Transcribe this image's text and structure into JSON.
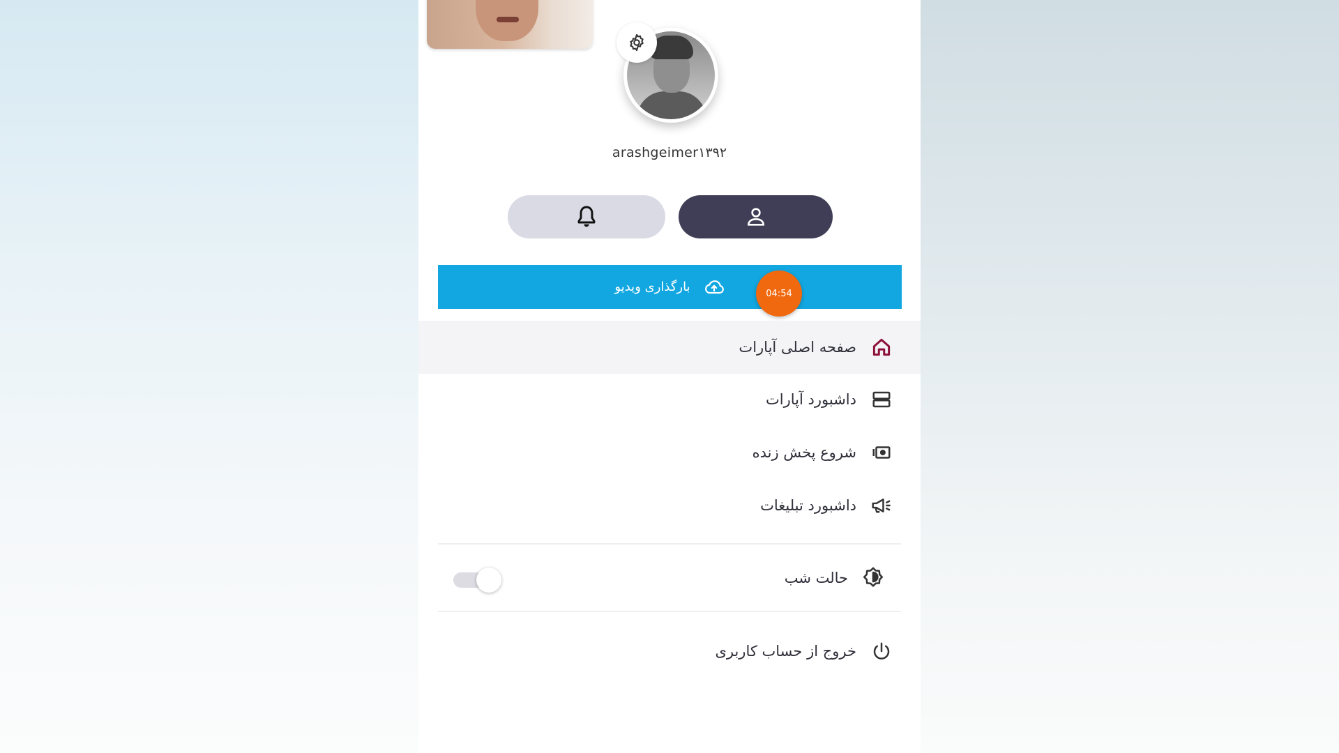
{
  "profile": {
    "username": "arashgeimer۱۳۹۲"
  },
  "buttons": {
    "upload_label": "بارگذاری ویدیو"
  },
  "recording": {
    "timer": "04:54",
    "color": "#f0690f"
  },
  "menu": {
    "items": [
      {
        "label": "صفحه اصلی آپارات",
        "icon": "home-icon"
      },
      {
        "label": "داشبورد آپارات",
        "icon": "dashboard-icon"
      },
      {
        "label": "شروع پخش زنده",
        "icon": "live-stream-icon"
      },
      {
        "label": "داشبورد تبلیغات",
        "icon": "megaphone-icon"
      }
    ],
    "night_mode_label": "حالت شب",
    "night_mode_on": false,
    "logout_label": "خروج از حساب کاربری"
  },
  "colors": {
    "accent": "#12a7e1",
    "profile_pill": "#3f3e56",
    "notif_pill": "#d9dae4",
    "home_icon": "#8c1138"
  }
}
